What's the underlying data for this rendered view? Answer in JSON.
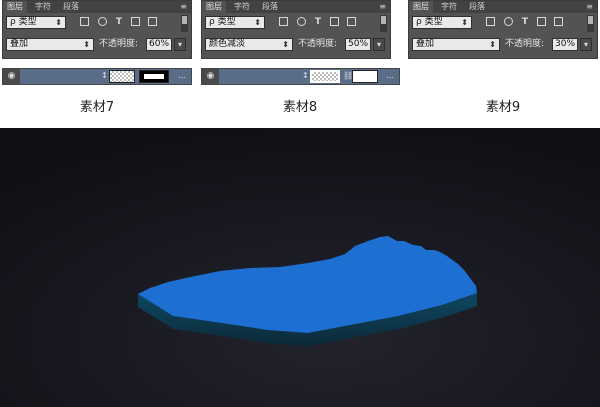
{
  "panels": [
    {
      "tab_layers": "图层",
      "tab_chars": "字符",
      "tab_para": "段落",
      "menu_icon": "≡",
      "search": "ρ 类型",
      "blend_mode": "叠加",
      "opacity_label": "不透明度:",
      "opacity_value": "60%",
      "caption": "素材7"
    },
    {
      "tab_layers": "图层",
      "tab_chars": "字符",
      "tab_para": "段落",
      "menu_icon": "≡",
      "search": "ρ 类型",
      "blend_mode": "颜色减淡",
      "opacity_label": "不透明度:",
      "opacity_value": "50%",
      "caption": "素材8"
    },
    {
      "tab_layers": "图层",
      "tab_chars": "字符",
      "tab_para": "段落",
      "menu_icon": "≡",
      "search": "ρ 类型",
      "blend_mode": "叠加",
      "opacity_label": "不透明度:",
      "opacity_value": "30%",
      "caption": "素材9"
    }
  ],
  "icons": {
    "eye": "eye-icon",
    "chain": "chain-link-icon",
    "filter_pixel": "image-filter-icon",
    "filter_adjust": "adjustment-filter-icon",
    "filter_type": "type-filter-icon",
    "filter_shape": "shape-filter-icon",
    "filter_smart": "smart-object-filter-icon",
    "menu": "panel-menu-icon"
  },
  "colors": {
    "panel_bg": "#535353",
    "layer_selected": "#596d89",
    "scene_bg": "#15151d",
    "lake_top": "#1d6fd1",
    "lake_side": "#0e3d52"
  }
}
